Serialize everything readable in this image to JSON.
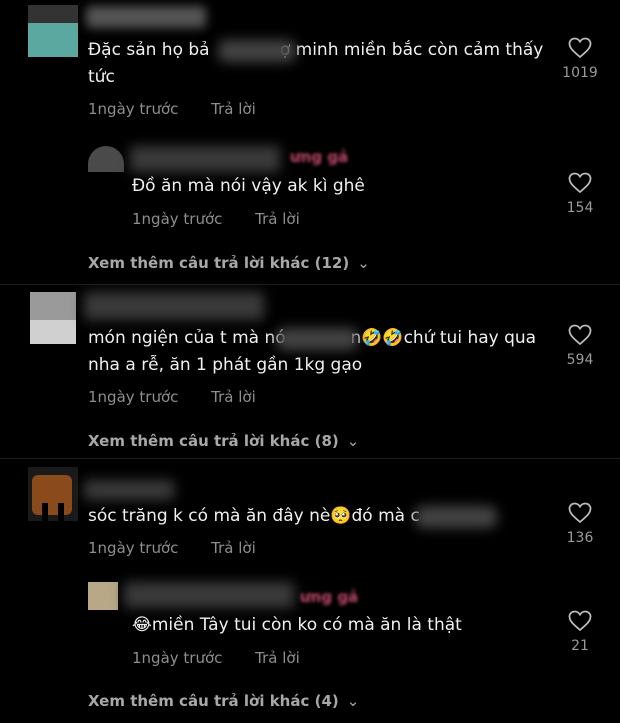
{
  "comments": [
    {
      "text": "Đặc sản họ bả             ợ minh miền bắc còn cảm thấy tức",
      "time": "1ngày trước",
      "reply": "Trả lời",
      "likes": "1019"
    },
    {
      "text": "Đồ ăn mà nói vậy ak kì ghê",
      "time": "1ngày trước",
      "reply": "Trả lời",
      "likes": "154",
      "name_fragment": "ưng gả"
    },
    {
      "text": "món ngiện của t mà nó            n🤣🤣chứ tui hay qua nha a rễ, ăn 1 phát gần 1kg gạo",
      "time": "1ngày trước",
      "reply": "Trả lời",
      "likes": "594"
    },
    {
      "text": "sóc trăng k có mà ăn đây nè🥺đó mà c",
      "time": "1ngày trước",
      "reply": "Trả lời",
      "likes": "136"
    },
    {
      "text": "😂miền Tây tui còn ko có mà ăn là thật",
      "time": "1ngày trước",
      "reply": "Trả lời",
      "likes": "21",
      "name_fragment": "ưng gả"
    }
  ],
  "more_replies": [
    "Xem thêm câu trả lời khác (12)",
    "Xem thêm câu trả lời khác (8)",
    "Xem thêm câu trả lời khác (4)"
  ],
  "icons": {
    "like": "heart-outline-icon",
    "expand": "chevron-down-icon"
  }
}
